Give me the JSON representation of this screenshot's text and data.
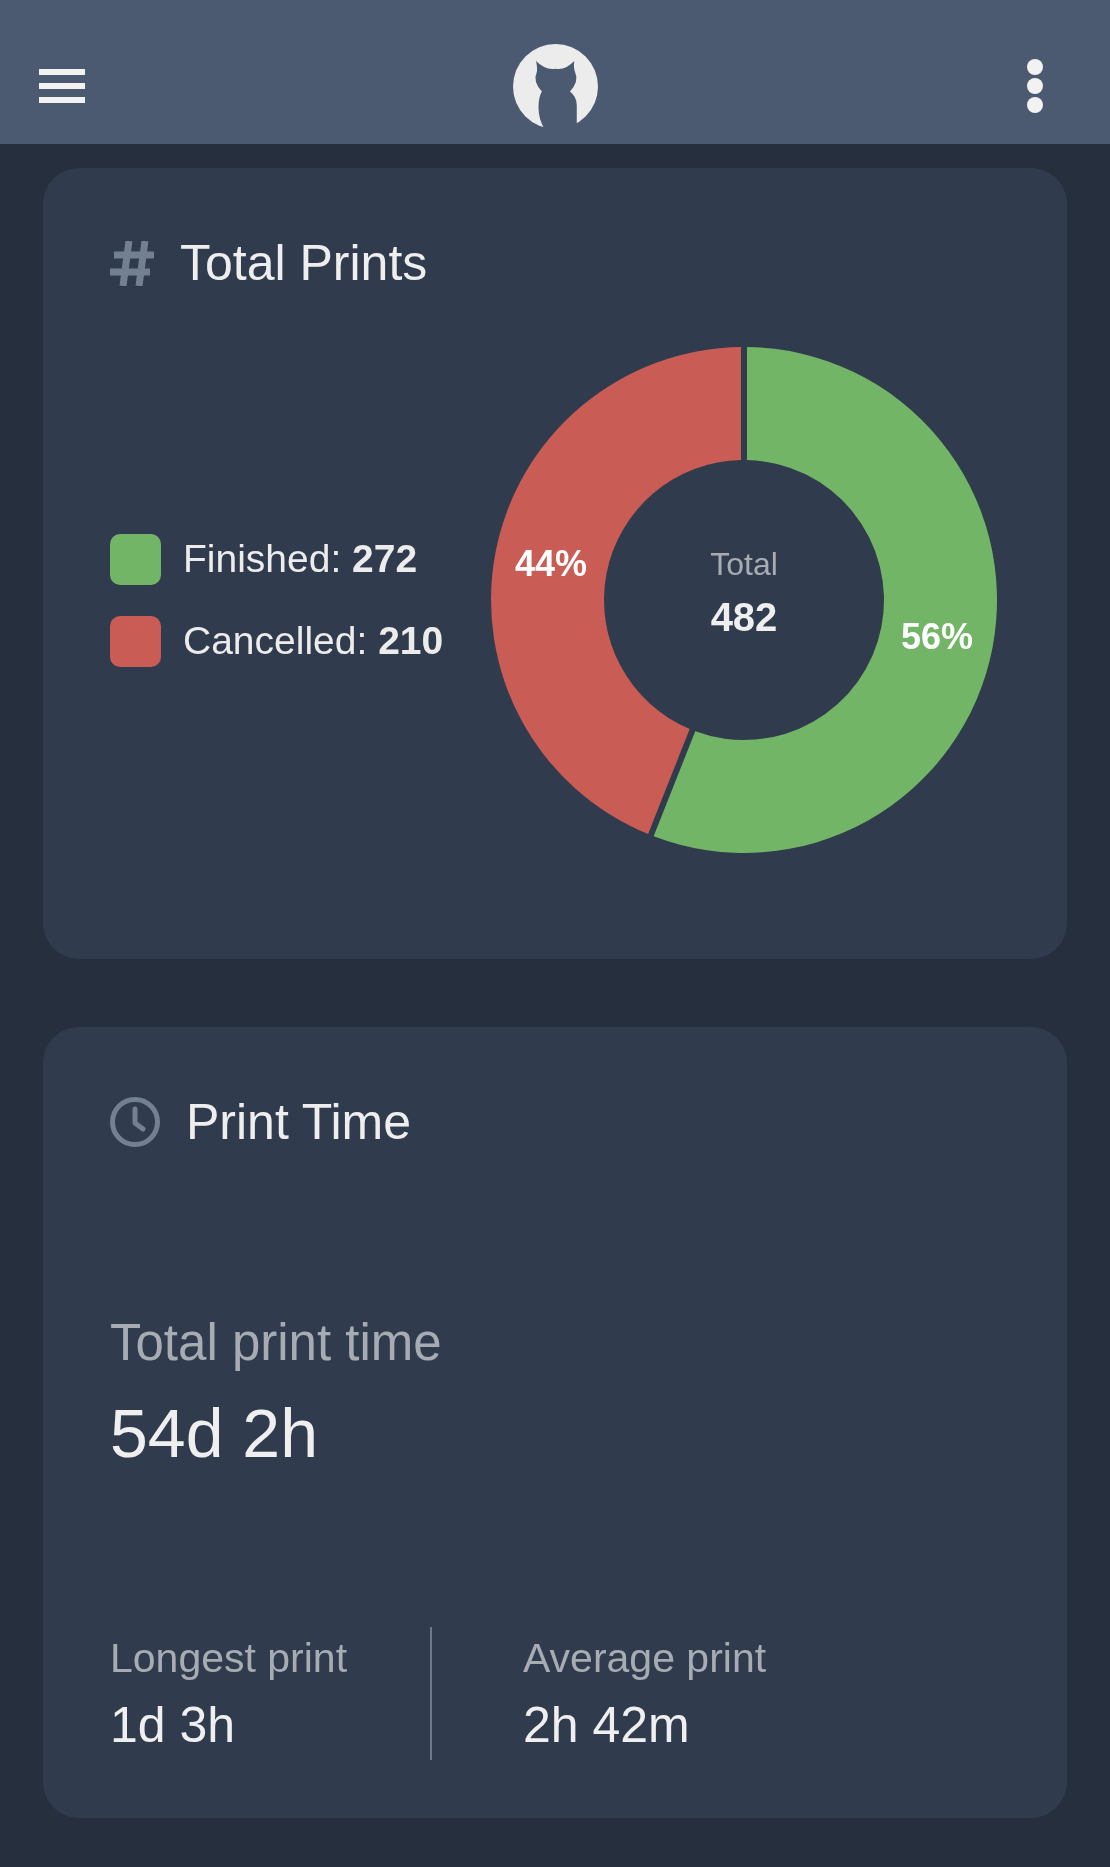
{
  "total_prints": {
    "title": "Total Prints",
    "legend": [
      {
        "label": "Finished:",
        "value": "272",
        "color": "#73b566"
      },
      {
        "label": "Cancelled:",
        "value": "210",
        "color": "#c95c55"
      }
    ],
    "chart_data": {
      "type": "donut",
      "values": [
        56,
        44
      ],
      "value_labels": [
        "56%",
        "44%"
      ]
    },
    "center_label": "Total",
    "center_value": "482"
  },
  "print_time": {
    "title": "Print Time",
    "total_label": "Total print time",
    "total_value": "54d 2h",
    "stats": [
      {
        "label": "Longest print",
        "value": "1d 3h"
      },
      {
        "label": "Average print",
        "value": "2h 42m"
      }
    ]
  }
}
